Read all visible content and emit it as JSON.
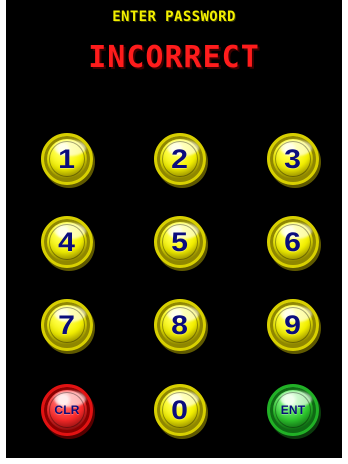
{
  "header": {
    "prompt": "ENTER PASSWORD",
    "status": "INCORRECT"
  },
  "keys": {
    "one": "1",
    "two": "2",
    "three": "3",
    "four": "4",
    "five": "5",
    "six": "6",
    "seven": "7",
    "eight": "8",
    "nine": "9",
    "clear": "CLR",
    "zero": "0",
    "enter": "ENT"
  },
  "colors": {
    "screen": "#000000",
    "prompt": "#f3f000",
    "status": "#ff1c1c",
    "digit_key": "#f6f300",
    "clear_key": "#ff2b2b",
    "enter_key": "#2fcb2f",
    "label": "#0b0d7d"
  }
}
